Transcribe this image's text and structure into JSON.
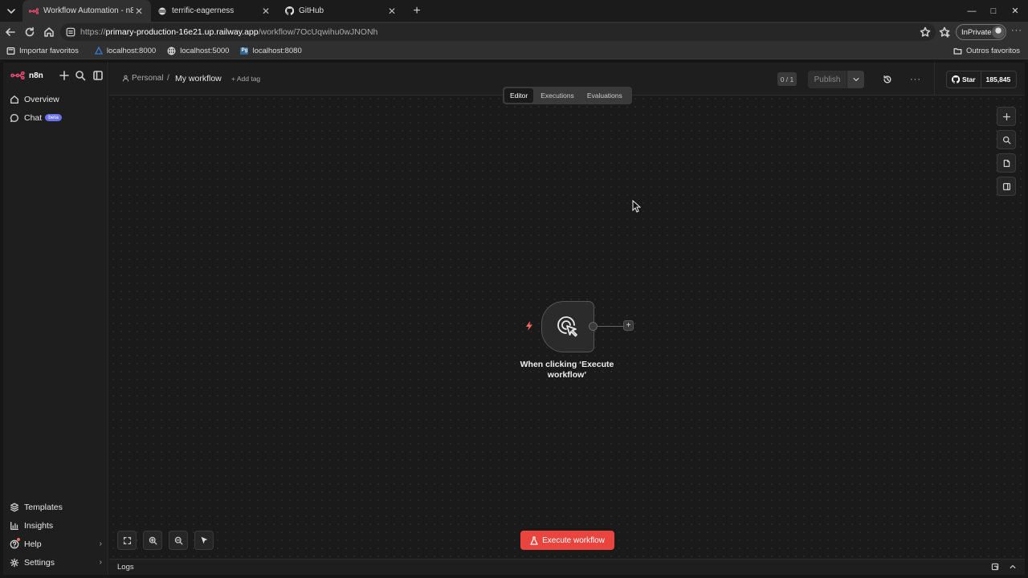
{
  "browser": {
    "tabs": [
      {
        "title": "Workflow Automation - n8n",
        "active": true
      },
      {
        "title": "terrific-eagerness",
        "active": false
      },
      {
        "title": "GitHub",
        "active": false
      }
    ],
    "address": {
      "scheme": "https://",
      "host": "primary-production-16e21.up.railway.app",
      "path": "/workflow/7OcUqwihu0wJNONh"
    },
    "inprivate_label": "InPrivate",
    "favorites": [
      {
        "label": "Importar favoritos",
        "icon": "import-icon"
      },
      {
        "label": "localhost:8000",
        "icon": "triangle-icon"
      },
      {
        "label": "localhost:5000",
        "icon": "globe-icon"
      },
      {
        "label": "localhost:8080",
        "icon": "pg-icon",
        "badge": "Pg"
      }
    ],
    "other_favorites": "Outros favoritos"
  },
  "sidebar": {
    "brand": "n8n",
    "items": [
      {
        "label": "Overview",
        "icon": "home-icon"
      },
      {
        "label": "Chat",
        "icon": "chat-icon",
        "badge": "beta"
      }
    ],
    "bottom_items": [
      {
        "label": "Templates",
        "icon": "templates-icon"
      },
      {
        "label": "Insights",
        "icon": "insights-icon"
      },
      {
        "label": "Help",
        "icon": "help-icon"
      },
      {
        "label": "Settings",
        "icon": "settings-icon"
      }
    ]
  },
  "header": {
    "project": "Personal",
    "separator": "/",
    "workflow_name": "My workflow",
    "add_tag": "+ Add tag",
    "counter": "0 / 1",
    "publish_label": "Publish",
    "github_star": "Star",
    "github_count": "185,845"
  },
  "modes": [
    {
      "label": "Editor",
      "active": true
    },
    {
      "label": "Executions",
      "active": false
    },
    {
      "label": "Evaluations",
      "active": false
    }
  ],
  "node": {
    "label": "When clicking ‘Execute workflow’"
  },
  "execute_label": "Execute workflow",
  "logs_label": "Logs",
  "colors": {
    "brand": "#ea4b71",
    "execute": "#e9443d",
    "trigger": "#f06a5d"
  }
}
